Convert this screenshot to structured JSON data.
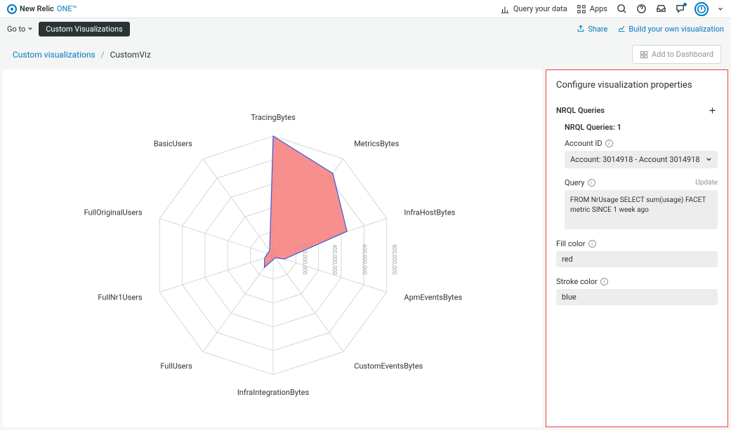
{
  "topbar": {
    "brand_prefix": "New Relic",
    "brand_suffix": "ONE™",
    "query_data": "Query your data",
    "apps": "Apps"
  },
  "subbar": {
    "goto": "Go to",
    "pill": "Custom Visualizations",
    "share": "Share",
    "build": "Build your own visualization"
  },
  "crumbs": {
    "root": "Custom visualizations",
    "sep": "/",
    "current": "CustomViz",
    "add_dashboard": "Add to Dashboard"
  },
  "config": {
    "title": "Configure visualization properties",
    "nrql_label": "NRQL Queries",
    "nrql_count": "NRQL Queries: 1",
    "account_id_label": "Account ID",
    "account_value": "Account: 3014918 - Account 3014918",
    "query_label": "Query",
    "update": "Update",
    "query_value": "FROM NrUsage SELECT sum(usage) FACET metric SINCE 1 week ago",
    "fill_label": "Fill color",
    "fill_value": "red",
    "stroke_label": "Stroke color",
    "stroke_value": "blue"
  },
  "chart_data": {
    "type": "radar",
    "categories": [
      "TracingBytes",
      "MetricsBytes",
      "InfraHostBytes",
      "ApmEventsBytes",
      "CustomEventsBytes",
      "InfraIntegrationBytes",
      "FullUsers",
      "FullNr1Users",
      "FullOriginalUsers",
      "BasicUsers"
    ],
    "values": [
      800000000,
      680000000,
      520000000,
      80000000,
      20000000,
      30000000,
      100000000,
      60000000,
      40000000,
      40000000
    ],
    "max": 800000000,
    "ticks": [
      "200,000,000",
      "400,000,000",
      "600,000,000",
      "800,000,000"
    ],
    "rings": 5
  }
}
